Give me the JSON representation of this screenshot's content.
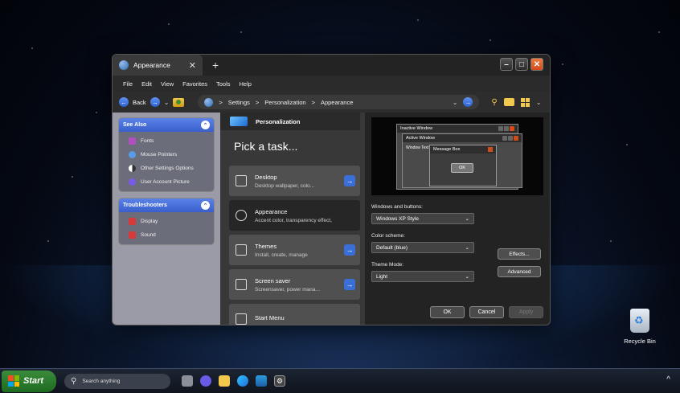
{
  "window": {
    "tab_title": "Appearance",
    "tab_close": "✕",
    "new_tab": "+"
  },
  "menu": [
    "File",
    "Edit",
    "View",
    "Favorites",
    "Tools",
    "Help"
  ],
  "nav": {
    "back_label": "Back",
    "address": [
      "Settings",
      "Personalization",
      "Appearance"
    ],
    "separator": ">"
  },
  "see_also": {
    "title": "See Also",
    "items": [
      "Fonts",
      "Mouse Pointers",
      "Other Settings Options",
      "User Account Picture"
    ]
  },
  "troubleshooters": {
    "title": "Troubleshooters",
    "items": [
      "Display",
      "Sound"
    ]
  },
  "middle": {
    "breadcrumb": "Personalization",
    "heading": "Pick a task...",
    "tasks": [
      {
        "title": "Desktop",
        "desc": "Desktop wallpaper, colo..."
      },
      {
        "title": "Appearance",
        "desc": "Accent color, transparency effect,"
      },
      {
        "title": "Themes",
        "desc": "Install, create, manage"
      },
      {
        "title": "Screen saver",
        "desc": "Screensaver, power mana..."
      },
      {
        "title": "Start Menu",
        "desc": ""
      }
    ]
  },
  "preview": {
    "inactive_title": "Inactive Window",
    "active_title": "Active Window",
    "window_text": "Window Text",
    "message_title": "Message Box",
    "ok": "OK"
  },
  "settings": {
    "windows_buttons_label": "Windows and buttons:",
    "windows_buttons_value": "Windows XP Style",
    "color_scheme_label": "Color scheme:",
    "color_scheme_value": "Default (blue)",
    "theme_mode_label": "Theme Mode:",
    "theme_mode_value": "Light",
    "effects": "Effects...",
    "advanced": "Advanced"
  },
  "dialog_buttons": {
    "ok": "OK",
    "cancel": "Cancel",
    "apply": "Apply"
  },
  "desktop": {
    "recycle_bin": "Recycle Bin"
  },
  "taskbar": {
    "start": "Start",
    "search_placeholder": "Search anything"
  },
  "colors": {
    "accent": "#3a6fd8",
    "panel_header": "#4a6fe0",
    "close": "#d24c1a"
  }
}
